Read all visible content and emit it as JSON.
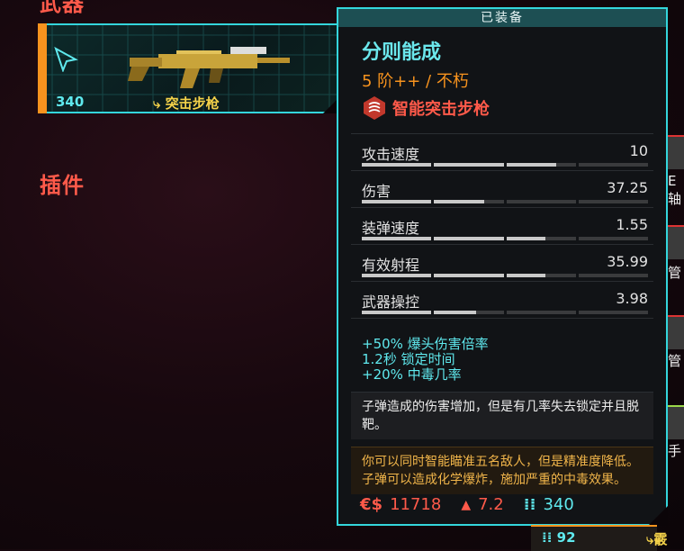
{
  "sections": {
    "weapon_label": "武器",
    "mods_label": "插件"
  },
  "equipped_weapon_card": {
    "ammo": "340",
    "ammo_icon_text": "⁞⁞",
    "type": "突击步枪",
    "type_icon": "smart-rifle-icon"
  },
  "tooltip": {
    "header": "已装备",
    "name": "分则能成",
    "tier": "5 阶++ / 不朽",
    "class_icon": "smart-weapon-icon",
    "class": "智能突击步枪",
    "stats": [
      {
        "name": "攻击速度",
        "value": "10",
        "fill": 0.68
      },
      {
        "name": "伤害",
        "value": "37.25",
        "fill": 0.43
      },
      {
        "name": "装弹速度",
        "value": "1.55",
        "fill": 0.64
      },
      {
        "name": "有效射程",
        "value": "35.99",
        "fill": 0.64
      },
      {
        "name": "武器操控",
        "value": "3.98",
        "fill": 0.4
      }
    ],
    "mods": [
      "+50% 爆头伤害倍率",
      "1.2秒 锁定时间",
      "+20% 中毒几率"
    ],
    "description": "子弹造成的伤害增加，但是有几率失去锁定并且脱靶。",
    "lore": "你可以同时智能瞄准五名敌人，但是精准度降低。子弹可以造成化学爆炸，施加严重的中毒效果。",
    "footer": {
      "money_icon": "€$",
      "money": "11718",
      "weight_icon": "▲",
      "weight": "7.2",
      "ammo_icon": "⁞⁞",
      "ammo": "340"
    }
  },
  "edge_items": [
    "E 轴",
    "管",
    "管",
    "手"
  ],
  "bottom_item": {
    "ammo_icon": "⁞⁞",
    "ammo": "92",
    "label": "霰"
  },
  "colors": {
    "accent_cyan": "#34d6dc",
    "accent_red": "#ff5a4a",
    "accent_orange": "#f7931e",
    "accent_yellow": "#f4d24a"
  }
}
